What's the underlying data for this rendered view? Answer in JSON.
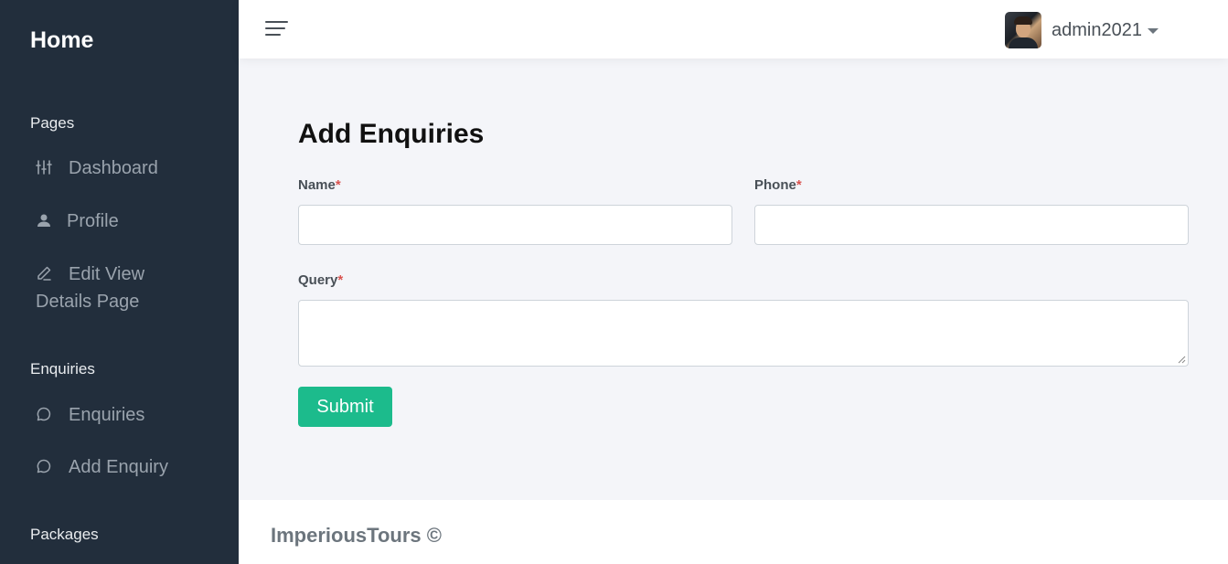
{
  "sidebar": {
    "brand": "Home",
    "sections": [
      {
        "header": "Pages",
        "items": [
          {
            "label": "Dashboard",
            "icon": "sliders-icon"
          },
          {
            "label": "Profile",
            "icon": "user-icon"
          },
          {
            "label_line1": "Edit View",
            "label_line2": "Details Page",
            "icon": "edit-icon"
          }
        ]
      },
      {
        "header": "Enquiries",
        "items": [
          {
            "label": "Enquiries",
            "icon": "message-circle-icon"
          },
          {
            "label": "Add Enquiry",
            "icon": "message-circle-icon"
          }
        ]
      },
      {
        "header": "Packages",
        "items": []
      }
    ]
  },
  "topbar": {
    "menu_icon": "hamburger-menu-icon",
    "user": {
      "name": "admin2021",
      "dropdown_icon": "caret-down-icon"
    }
  },
  "form": {
    "title": "Add Enquiries",
    "fields": [
      {
        "label": "Name",
        "required_mark": "*",
        "value": "",
        "placeholder": ""
      },
      {
        "label": "Phone",
        "required_mark": "*",
        "value": "",
        "placeholder": ""
      },
      {
        "label": "Query",
        "required_mark": "*",
        "value": "",
        "placeholder": ""
      }
    ],
    "submit_label": "Submit"
  },
  "footer": {
    "text": "ImperiousTours ©"
  },
  "colors": {
    "sidebar_bg": "#222e3c",
    "submit_green": "#1cbb8c",
    "required_red": "#d9534f",
    "content_bg": "#f4f5f9"
  }
}
